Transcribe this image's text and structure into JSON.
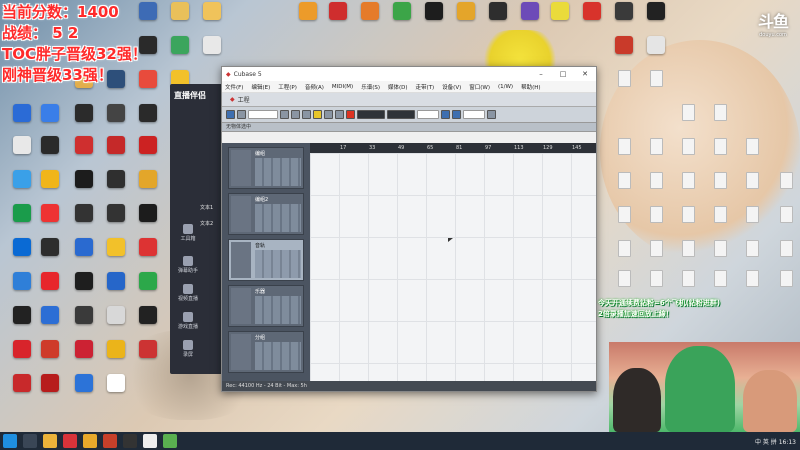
{
  "overlay": {
    "line1": "当前分数：1400",
    "line2": "战绩： 5 2",
    "line3": "TOC胖子晋级32强！",
    "line4": "刚神晋级33强！"
  },
  "douyu": {
    "logo": "斗鱼",
    "url": "douyu.com"
  },
  "desktop_icons": [
    {
      "label": "",
      "color": "#2e6fd1"
    },
    {
      "label": "",
      "color": "#e6a01f"
    },
    {
      "label": "",
      "color": "#cfd7e1"
    },
    {
      "label": "",
      "color": "#2b9bd8"
    },
    {
      "label": "",
      "color": "#e6502e"
    }
  ],
  "side_app": {
    "brand": "直播伴侣",
    "nav": [
      "工具箱",
      "弹幕助手",
      "视频直播",
      "游戏直播",
      "录屏"
    ],
    "recent": [
      "文本1",
      "文本2"
    ]
  },
  "cubase": {
    "window_title": "Cubase 5",
    "menus": [
      "文件(F)",
      "编辑(E)",
      "工程(P)",
      "音频(A)",
      "MIDI(M)",
      "乐谱(S)",
      "媒体(D)",
      "走带(T)",
      "设备(V)",
      "窗口(W)",
      "(1/W)",
      "帮助(H)"
    ],
    "project_title": "工程",
    "info": "无物体选中",
    "tracks": [
      "编组",
      "编组2",
      "音轨",
      "乐器",
      "分组"
    ],
    "ruler_marks": [
      "17",
      "33",
      "49",
      "65",
      "81",
      "97",
      "113",
      "129",
      "145"
    ],
    "status": "Rec: 44100 Hz - 24 Bit - Max: 5h"
  },
  "webcam": {
    "caption_line1": "今天开通续费钻粉=6个飞机(钻粉进群)",
    "caption_line2": "2倍录播加速回放上線！"
  },
  "taskbar": {
    "tray_text": "中 英 拼 16:13"
  },
  "colors": {
    "overlay_text": "#ff2a2a",
    "caption_text": "#ffffff",
    "taskbar": "#1f2a38"
  }
}
